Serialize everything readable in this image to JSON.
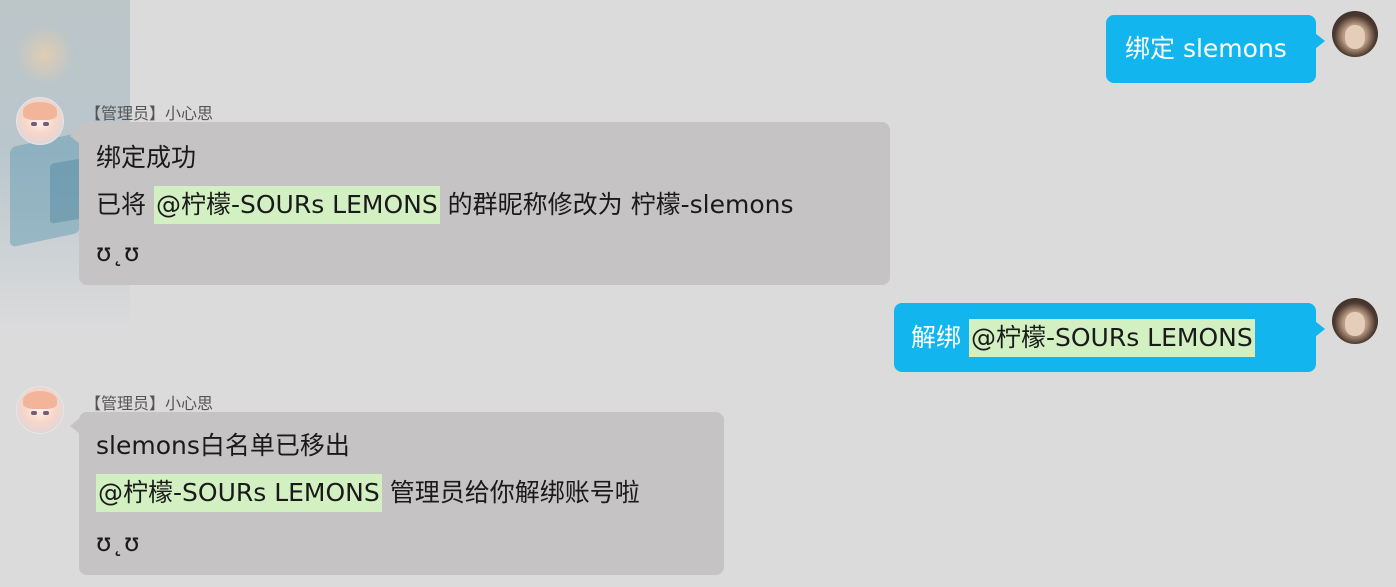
{
  "messages": [
    {
      "direction": "outgoing",
      "text": "绑定 slemons"
    },
    {
      "direction": "incoming",
      "sender": "【管理员】小心思",
      "line1": "绑定成功",
      "line2_prefix": "已将 ",
      "line2_mention": "@柠檬-SOURs LEMONS",
      "line2_suffix": " 的群昵称修改为 柠檬-slemons",
      "line3": "ʊ˛ʊ"
    },
    {
      "direction": "outgoing",
      "text_prefix": "解绑 ",
      "mention": "@柠檬-SOURs LEMONS"
    },
    {
      "direction": "incoming",
      "sender": "【管理员】小心思",
      "line1": "slemons白名单已移出",
      "line2_mention": "@柠檬-SOURs LEMONS",
      "line2_suffix": " 管理员给你解绑账号啦",
      "line3": "ʊ˛ʊ"
    }
  ],
  "colors": {
    "background": "#dcdbdc",
    "incoming_bubble": "#c5c3c4",
    "outgoing_bubble": "#13b5ee",
    "mention_highlight": "#d3f0c2"
  }
}
